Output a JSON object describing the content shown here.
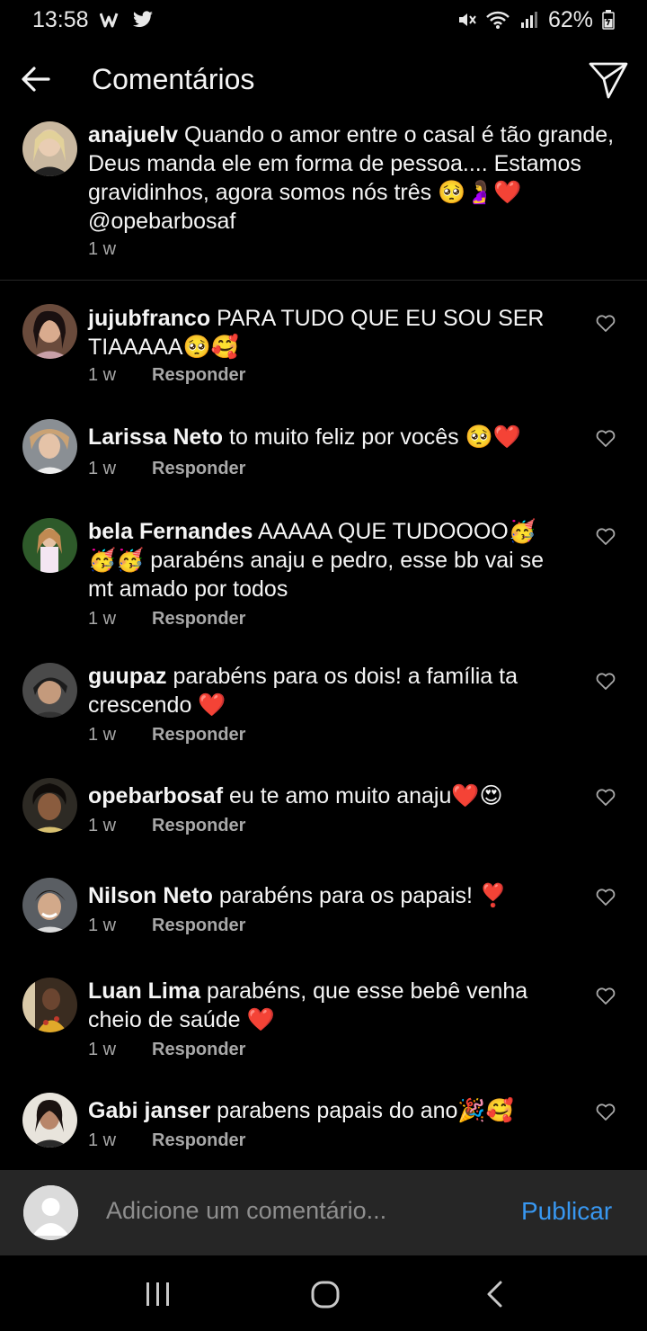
{
  "status_bar": {
    "time": "13:58",
    "battery": "62%"
  },
  "header": {
    "title": "Comentários"
  },
  "caption": {
    "username": "anajuelv",
    "text": "Quando o amor entre o casal é tão grande, Deus manda ele em forma de pessoa.... Estamos gravidinhos, agora somos nós três 🥺🤰❤️ @opebarbosaf",
    "time": "1 w"
  },
  "comments": [
    {
      "username": "jujubfranco",
      "text": "PARA TUDO QUE EU SOU SER TIAAAAA🥺🥰",
      "time": "1 w",
      "reply": "Responder"
    },
    {
      "username": "Larissa Neto",
      "text": "to muito feliz por vocês 🥺❤️",
      "time": "1 w",
      "reply": "Responder"
    },
    {
      "username": "bela Fernandes",
      "text": "AAAAA QUE TUDOOOO🥳🥳🥳 parabéns anaju e pedro, esse bb vai se mt amado por todos",
      "time": "1 w",
      "reply": "Responder"
    },
    {
      "username": "guupaz",
      "text": "parabéns para os dois! a família ta crescendo ❤️",
      "time": "1 w",
      "reply": "Responder"
    },
    {
      "username": "opebarbosaf",
      "text": "eu te amo muito anaju❤️😍",
      "time": "1 w",
      "reply": "Responder"
    },
    {
      "username": "Nilson Neto",
      "text": "parabéns para os papais! ❣️",
      "time": "1 w",
      "reply": "Responder"
    },
    {
      "username": "Luan Lima",
      "text": "parabéns, que esse bebê venha cheio de saúde ❤️",
      "time": "1 w",
      "reply": "Responder"
    },
    {
      "username": "Gabi janser",
      "text": "parabens papais do ano🎉🥰",
      "time": "1 w",
      "reply": "Responder"
    }
  ],
  "composer": {
    "placeholder": "Adicione um comentário...",
    "publish": "Publicar"
  },
  "colors": {
    "background": "#000000",
    "link": "#3897f0",
    "muted": "#a8a8a8",
    "composer_bg": "#262626"
  }
}
